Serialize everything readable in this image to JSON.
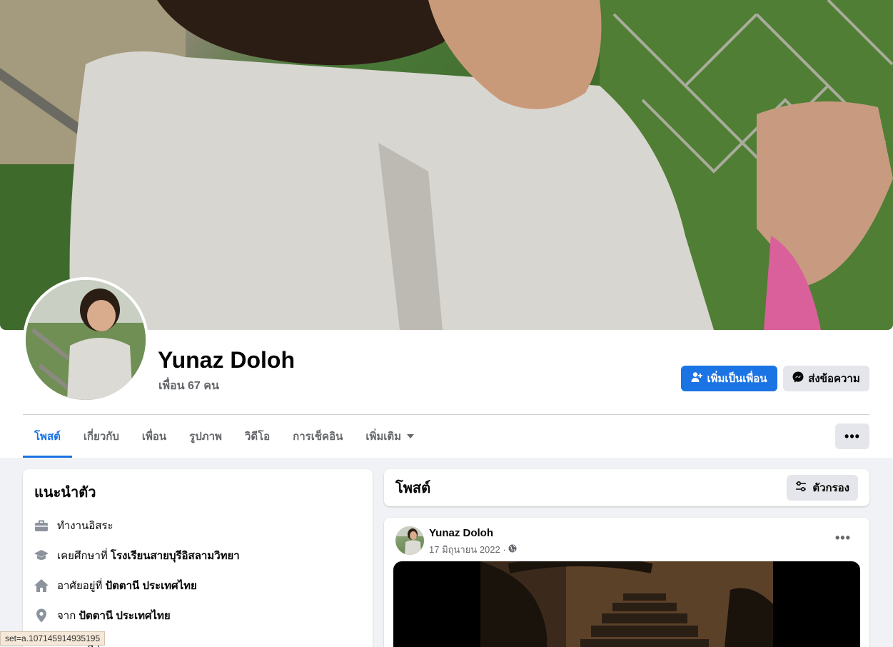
{
  "profile": {
    "name": "Yunaz Doloh",
    "friends": "เพื่อน 67 คน"
  },
  "actions": {
    "add_friend": "เพิ่มเป็นเพื่อน",
    "message": "ส่งข้อความ",
    "more": "•••"
  },
  "tabs": [
    {
      "label": "โพสต์",
      "active": true
    },
    {
      "label": "เกี่ยวกับ"
    },
    {
      "label": "เพื่อน"
    },
    {
      "label": "รูปภาพ"
    },
    {
      "label": "วิดีโอ"
    },
    {
      "label": "การเช็คอิน"
    },
    {
      "label": "เพิ่มเติม"
    }
  ],
  "intro": {
    "title": "แนะนำตัว",
    "items": [
      {
        "icon": "briefcase-icon",
        "prefix": "ทำงานอิสระ",
        "bold": ""
      },
      {
        "icon": "graduation-cap-icon",
        "prefix": "เคยศึกษาที่ ",
        "bold": "โรงเรียนสายบุรีอิสลามวิทยา"
      },
      {
        "icon": "home-icon",
        "prefix": "อาศัยอยู่ที่ ",
        "bold": "ปัตตานี ประเทศไทย"
      },
      {
        "icon": "location-pin-icon",
        "prefix": "จาก ",
        "bold": "ปัตตานี ประเทศไทย"
      },
      {
        "icon": "heart-icon",
        "prefix": "ล้ว",
        "bold": ""
      }
    ]
  },
  "posts": {
    "title": "โพสต์",
    "filter_label": "ตัวกรอง",
    "post": {
      "author": "Yunaz Doloh",
      "date": "17 มิถุนายน 2022 ·",
      "more": "•••"
    }
  },
  "status_url": "set=a.107145914935195",
  "colors": {
    "accent": "#1b74e4",
    "button_gray": "#e4e6eb",
    "page_bg": "#f0f2f5",
    "secondary_text": "#65676b"
  }
}
